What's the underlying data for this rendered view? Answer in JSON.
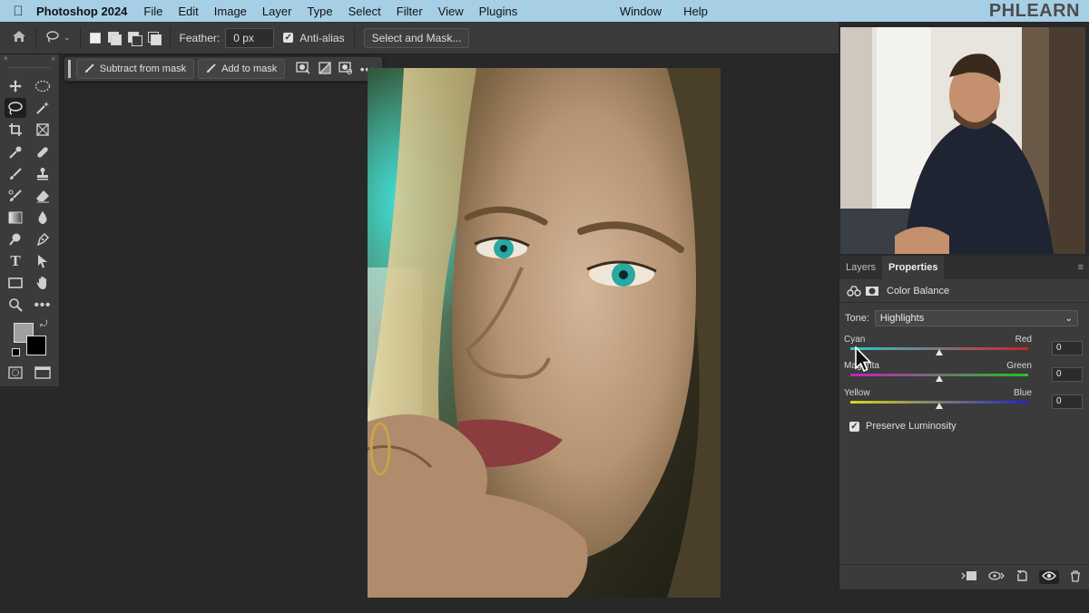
{
  "menubar": {
    "app_name": "Photoshop 2024",
    "items": [
      "File",
      "Edit",
      "Image",
      "Layer",
      "Type",
      "Select",
      "Filter",
      "View",
      "Plugins"
    ],
    "right_items": [
      "Window",
      "Help"
    ],
    "brand": "PHLEARN"
  },
  "options": {
    "feather_label": "Feather:",
    "feather_value": "0 px",
    "antialias_label": "Anti-alias",
    "antialias_checked": true,
    "select_mask_label": "Select and Mask..."
  },
  "taskbar": {
    "subtract_label": "Subtract from mask",
    "add_label": "Add to mask"
  },
  "panel": {
    "tabs": [
      "Layers",
      "Properties"
    ],
    "active_tab": "Properties",
    "adjustment_title": "Color Balance",
    "tone_label": "Tone:",
    "tone_value": "Highlights",
    "sliders": [
      {
        "left": "Cyan",
        "right": "Red",
        "value": "0",
        "gradient": [
          "#2ec8c8",
          "#d01f2a"
        ]
      },
      {
        "left": "Magenta",
        "right": "Green",
        "value": "0",
        "gradient": [
          "#c21fc2",
          "#21c421"
        ]
      },
      {
        "left": "Yellow",
        "right": "Blue",
        "value": "0",
        "gradient": [
          "#d7d71c",
          "#2424c8"
        ]
      }
    ],
    "preserve_label": "Preserve Luminosity",
    "preserve_checked": true
  },
  "colors": {
    "menubar_bg": "#a6cfe6",
    "panel_bg": "#3b3b3b",
    "canvas_bg": "#282828"
  },
  "icons": {
    "toolbar": [
      "move-icon",
      "marquee-icon",
      "lasso-icon",
      "magic-wand-icon",
      "crop-icon",
      "frame-icon",
      "eyedropper-icon",
      "healing-icon",
      "brush-icon",
      "stamp-icon",
      "history-brush-icon",
      "eraser-icon",
      "gradient-icon",
      "blur-icon",
      "dodge-icon",
      "pen-icon",
      "type-icon",
      "path-select-icon",
      "rectangle-icon",
      "hand-icon",
      "zoom-icon",
      "more-tools-icon"
    ]
  }
}
